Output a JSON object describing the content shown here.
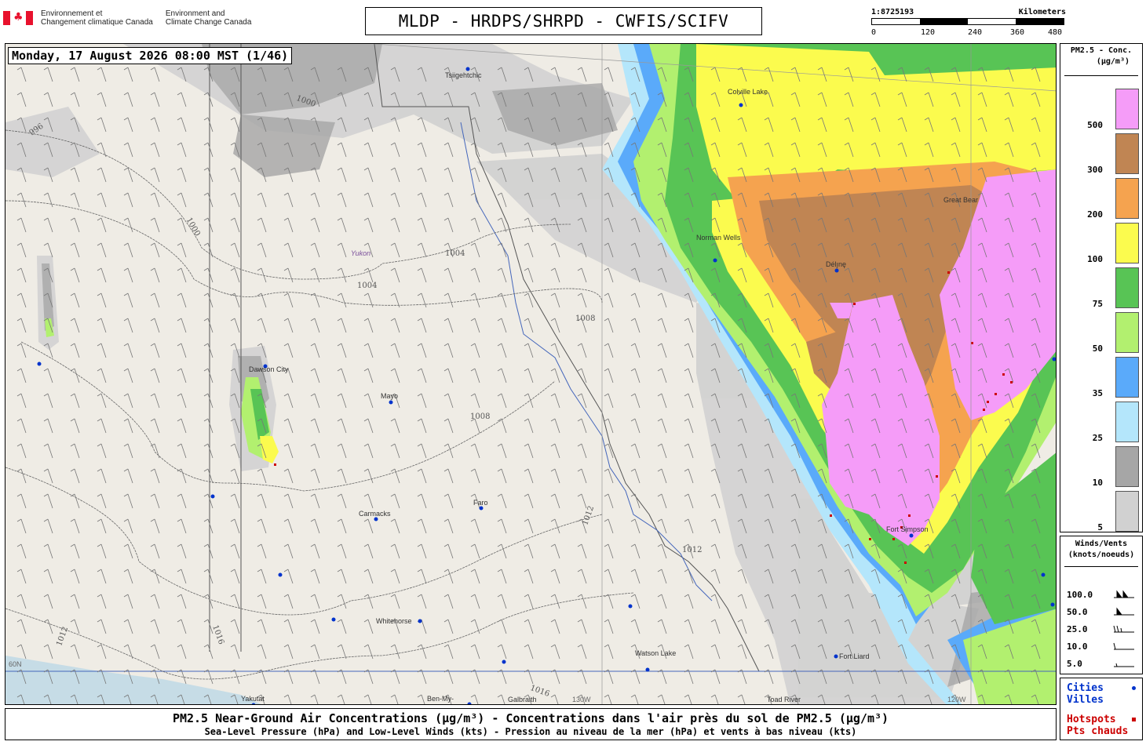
{
  "header": {
    "dept_fr": "Environnement et\nChangement climatique Canada",
    "dept_en": "Environment and\nClimate Change Canada",
    "title": "MLDP - HRDPS/SHRPD - CWFIS/SCIFV"
  },
  "scale": {
    "ratio": "1:8725193",
    "unit": "Kilometers",
    "ticks": [
      "0",
      "120",
      "240",
      "360",
      "480"
    ]
  },
  "map": {
    "datetime": "Monday, 17 August 2026 08:00 MST (1/46)",
    "region_label": "Yukon",
    "places": [
      {
        "name": "Tsiigehtchic"
      },
      {
        "name": "Colville Lake"
      },
      {
        "name": "Norman Wells"
      },
      {
        "name": "Délı̨nę"
      },
      {
        "name": "Great Bear"
      },
      {
        "name": "Dawson City"
      },
      {
        "name": "Mayo"
      },
      {
        "name": "Carmacks"
      },
      {
        "name": "Faro"
      },
      {
        "name": "Fort Simpson"
      },
      {
        "name": "Whitehorse"
      },
      {
        "name": "Watson Lake"
      },
      {
        "name": "Fort Liard"
      },
      {
        "name": "Yakutat"
      },
      {
        "name": "Ben-My-"
      },
      {
        "name": "Galbraith"
      },
      {
        "name": "Toad River"
      }
    ],
    "grid_labels": [
      "60N",
      "130W",
      "120W"
    ],
    "isobar_values": [
      "996",
      "1000",
      "1004",
      "1008",
      "1012",
      "1016"
    ]
  },
  "legend": {
    "title_line1": "PM2.5 - Conc.",
    "title_line2": "(µg/m³)",
    "bins": [
      {
        "label": "500",
        "color": "#f59cf8"
      },
      {
        "label": "300",
        "color": "#c08553"
      },
      {
        "label": "200",
        "color": "#f5a34f"
      },
      {
        "label": "100",
        "color": "#fbfb4e"
      },
      {
        "label": "75",
        "color": "#58c455"
      },
      {
        "label": "50",
        "color": "#b2f06f"
      },
      {
        "label": "35",
        "color": "#5aaafa"
      },
      {
        "label": "25",
        "color": "#b4e6fb"
      },
      {
        "label": "10",
        "color": "#a6a6a6"
      },
      {
        "label": "5",
        "color": "#d1d1d1"
      }
    ]
  },
  "wind_legend": {
    "title_line1": "Winds/Vents",
    "title_line2": "(knots/noeuds)",
    "rows": [
      {
        "label": "100.0"
      },
      {
        "label": "50.0"
      },
      {
        "label": "25.0"
      },
      {
        "label": "10.0"
      },
      {
        "label": "5.0"
      }
    ]
  },
  "key": {
    "cities_en": "Cities",
    "cities_fr": "Villes",
    "hotspots_en": "Hotspots",
    "hotspots_fr": "Pts chauds",
    "city_color": "#0033cc",
    "hotspot_color": "#cc0000"
  },
  "footer": {
    "line1": "PM2.5 Near-Ground Air Concentrations (µg/m³) - Concentrations dans l'air près du sol de PM2.5 (µg/m³)",
    "line2": "Sea-Level Pressure (hPa) and Low-Level Winds (kts) - Pression au niveau de la mer (hPa) et vents à bas niveau (kts)"
  }
}
